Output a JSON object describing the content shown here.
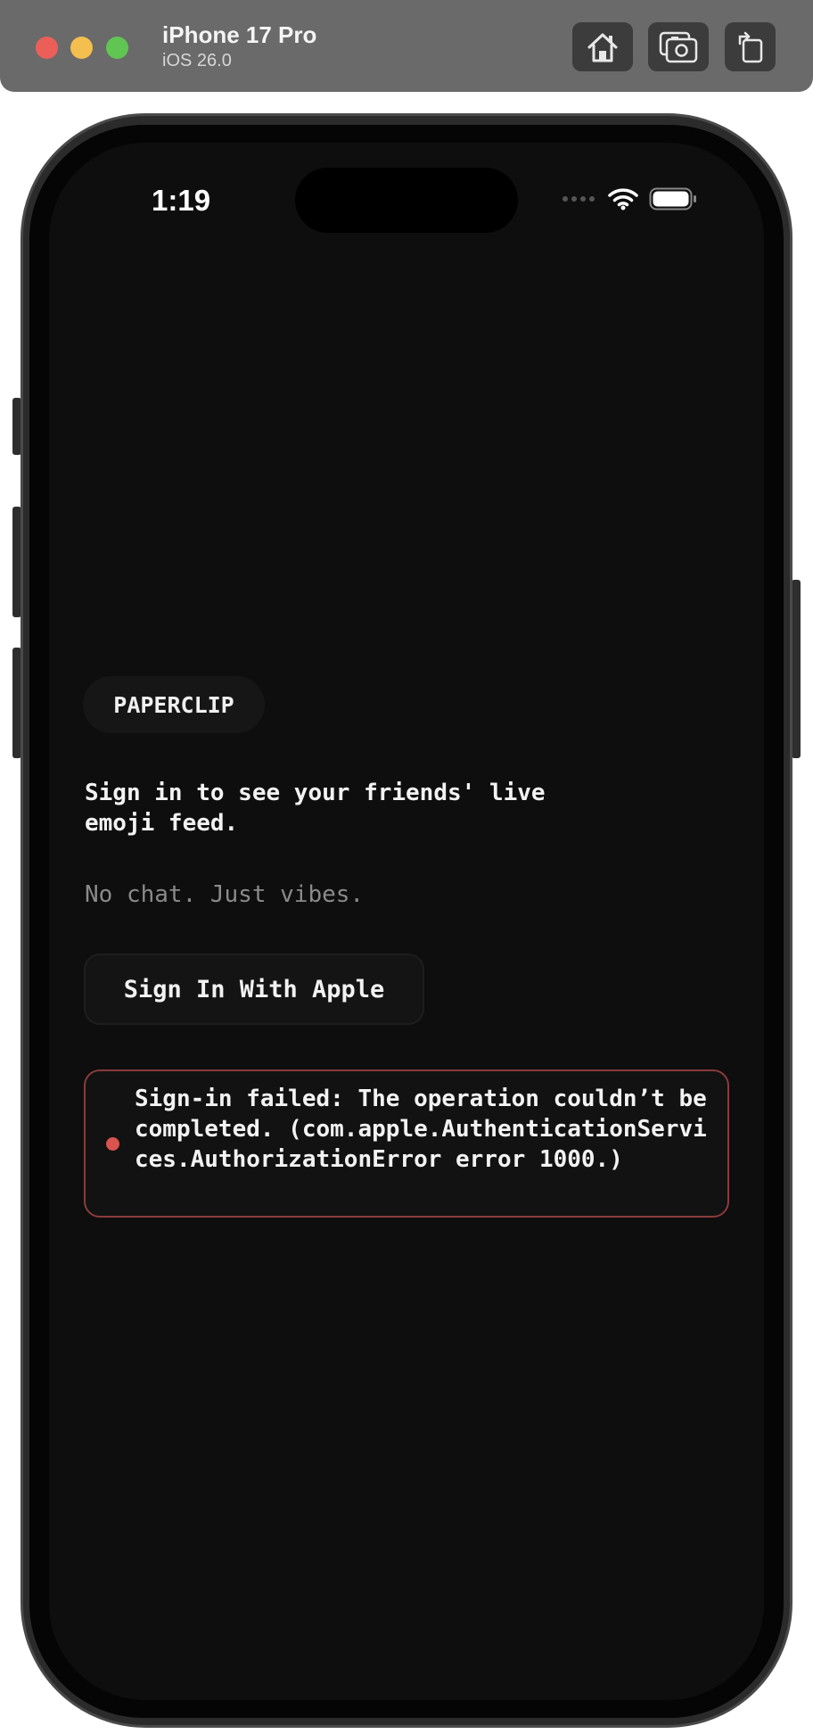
{
  "simulator": {
    "device_name": "iPhone 17 Pro",
    "os_version": "iOS 26.0",
    "icons": [
      "home-icon",
      "screenshot-icon",
      "rotate-icon"
    ]
  },
  "status_bar": {
    "time": "1:19",
    "icons": [
      "signal-dots-icon",
      "wifi-icon",
      "battery-icon"
    ]
  },
  "app": {
    "brand": "PAPERCLIP",
    "headline": "Sign in to see your friends' live emoji feed.",
    "tagline": "No chat. Just vibes.",
    "signin_button": "Sign In With Apple",
    "error_message": "Sign-in failed: The operation couldn’t be completed. (com.apple.AuthenticationServices.AuthorizationError error 1000.)"
  },
  "colors": {
    "background": "#0e0e0e",
    "error_border": "#8a3b3b",
    "error_dot": "#d9534f"
  }
}
